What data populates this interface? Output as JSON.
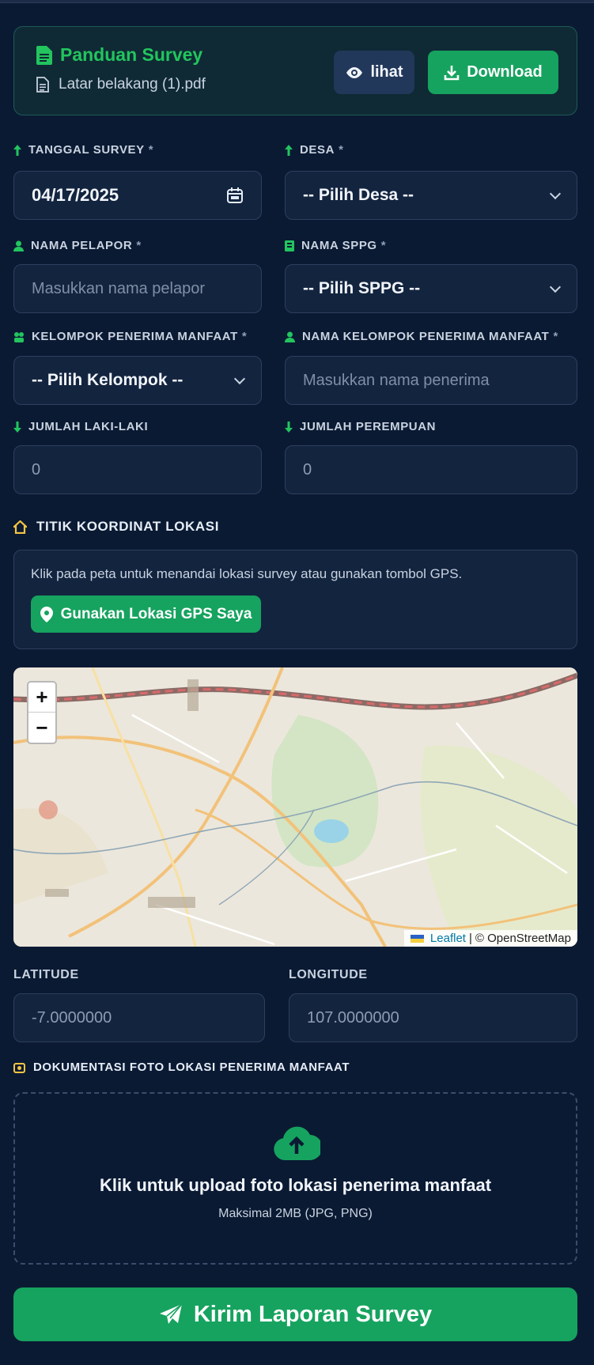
{
  "guide": {
    "title": "Panduan Survey",
    "file_name": "Latar belakang (1).pdf",
    "view_label": "lihat",
    "download_label": "Download"
  },
  "form": {
    "tanggal": {
      "label": "TANGGAL SURVEY",
      "required": "*",
      "value": "04/17/2025"
    },
    "desa": {
      "label": "DESA",
      "required": "*",
      "value": "-- Pilih Desa --"
    },
    "nama_pelapor": {
      "label": "NAMA PELAPOR",
      "required": "*",
      "placeholder": "Masukkan nama pelapor"
    },
    "nama_sppg": {
      "label": "NAMA SPPG",
      "required": "*",
      "value": "-- Pilih SPPG --"
    },
    "kelompok": {
      "label": "KELOMPOK PENERIMA MANFAAT",
      "required": "*",
      "value": "-- Pilih Kelompok --"
    },
    "nama_kelompok": {
      "label": "NAMA KELOMPOK PENERIMA MANFAAT",
      "required": "*",
      "placeholder": "Masukkan nama penerima"
    },
    "laki": {
      "label": "JUMLAH LAKI-LAKI",
      "placeholder": "0"
    },
    "perempuan": {
      "label": "JUMLAH PEREMPUAN",
      "placeholder": "0"
    }
  },
  "coordinates": {
    "section_title": "TITIK KOORDINAT LOKASI",
    "help_text": "Klik pada peta untuk menandai lokasi survey atau gunakan tombol GPS.",
    "gps_button": "Gunakan Lokasi GPS Saya",
    "latitude_label": "LATITUDE",
    "latitude_placeholder": "-7.0000000",
    "longitude_label": "LONGITUDE",
    "longitude_placeholder": "107.0000000"
  },
  "map": {
    "zoom_in": "+",
    "zoom_out": "−",
    "attribution_leaflet": "Leaflet",
    "attribution_sep": "|",
    "attribution_osm": "© OpenStreetMap"
  },
  "upload": {
    "section_title": "DOKUMENTASI FOTO LOKASI PENERIMA MANFAAT",
    "title": "Klik untuk upload foto lokasi penerima manfaat",
    "subtitle": "Maksimal 2MB (JPG, PNG)"
  },
  "submit_label": "Kirim Laporan Survey",
  "colors": {
    "background": "#0b1a33",
    "accent_green": "#16a35f",
    "label_icon_green": "#22c55e",
    "section_icon_yellow": "#f5c542"
  },
  "icons": {
    "guide": "document-icon",
    "file": "pdf-file-icon",
    "view": "eye-icon",
    "download": "download-icon",
    "date": "calendar-icon",
    "gps": "location-pin-icon",
    "upload": "cloud-upload-icon",
    "submit": "paper-plane-icon"
  }
}
